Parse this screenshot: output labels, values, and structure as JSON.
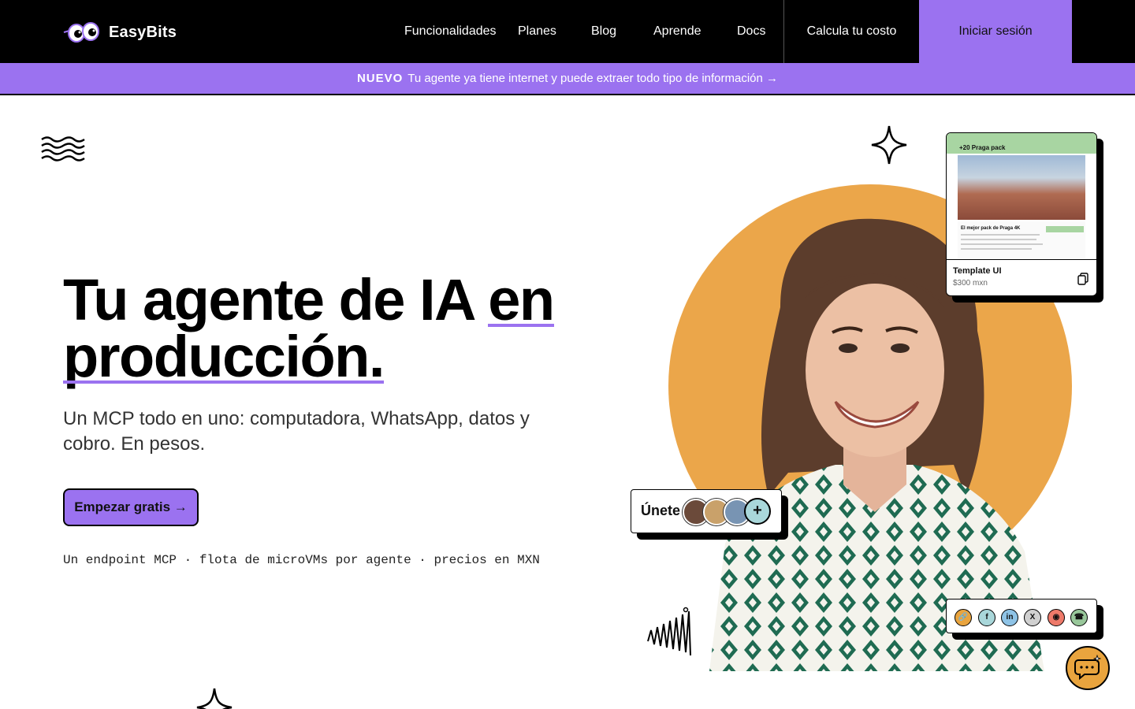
{
  "brand": {
    "name": "EasyBits"
  },
  "nav": {
    "links": [
      "Funcionalidades",
      "Planes",
      "Blog",
      "Aprende",
      "Docs"
    ],
    "cost_label": "Calcula tu costo",
    "login_label": "Iniciar sesión"
  },
  "banner": {
    "tag": "NUEVO",
    "text": "Tu agente ya tiene internet y puede extraer todo tipo de información →"
  },
  "hero": {
    "title_part1": "Tu agente de IA ",
    "title_underlined1": "en",
    "title_underlined2": "producción.",
    "subtitle": "Un MCP todo en uno: computadora, WhatsApp, datos y cobro. En pesos.",
    "cta_label": "Empezar gratis →",
    "mono_line": "Un endpoint MCP · flota de microVMs por agente · precios en MXN"
  },
  "template_card": {
    "header": "+20 Praga pack",
    "section_title": "El mejor pack de Praga 4K",
    "name": "Template UI",
    "price": "$300 mxn",
    "icon": "copy-icon"
  },
  "join_card": {
    "label": "Únete",
    "plus": "+"
  },
  "social_icons": [
    "link-icon",
    "facebook-icon",
    "linkedin-icon",
    "x-icon",
    "instagram-icon",
    "whatsapp-icon"
  ],
  "colors": {
    "accent": "#9b72f0",
    "orange": "#eba64a",
    "nav_bg": "#000000"
  }
}
